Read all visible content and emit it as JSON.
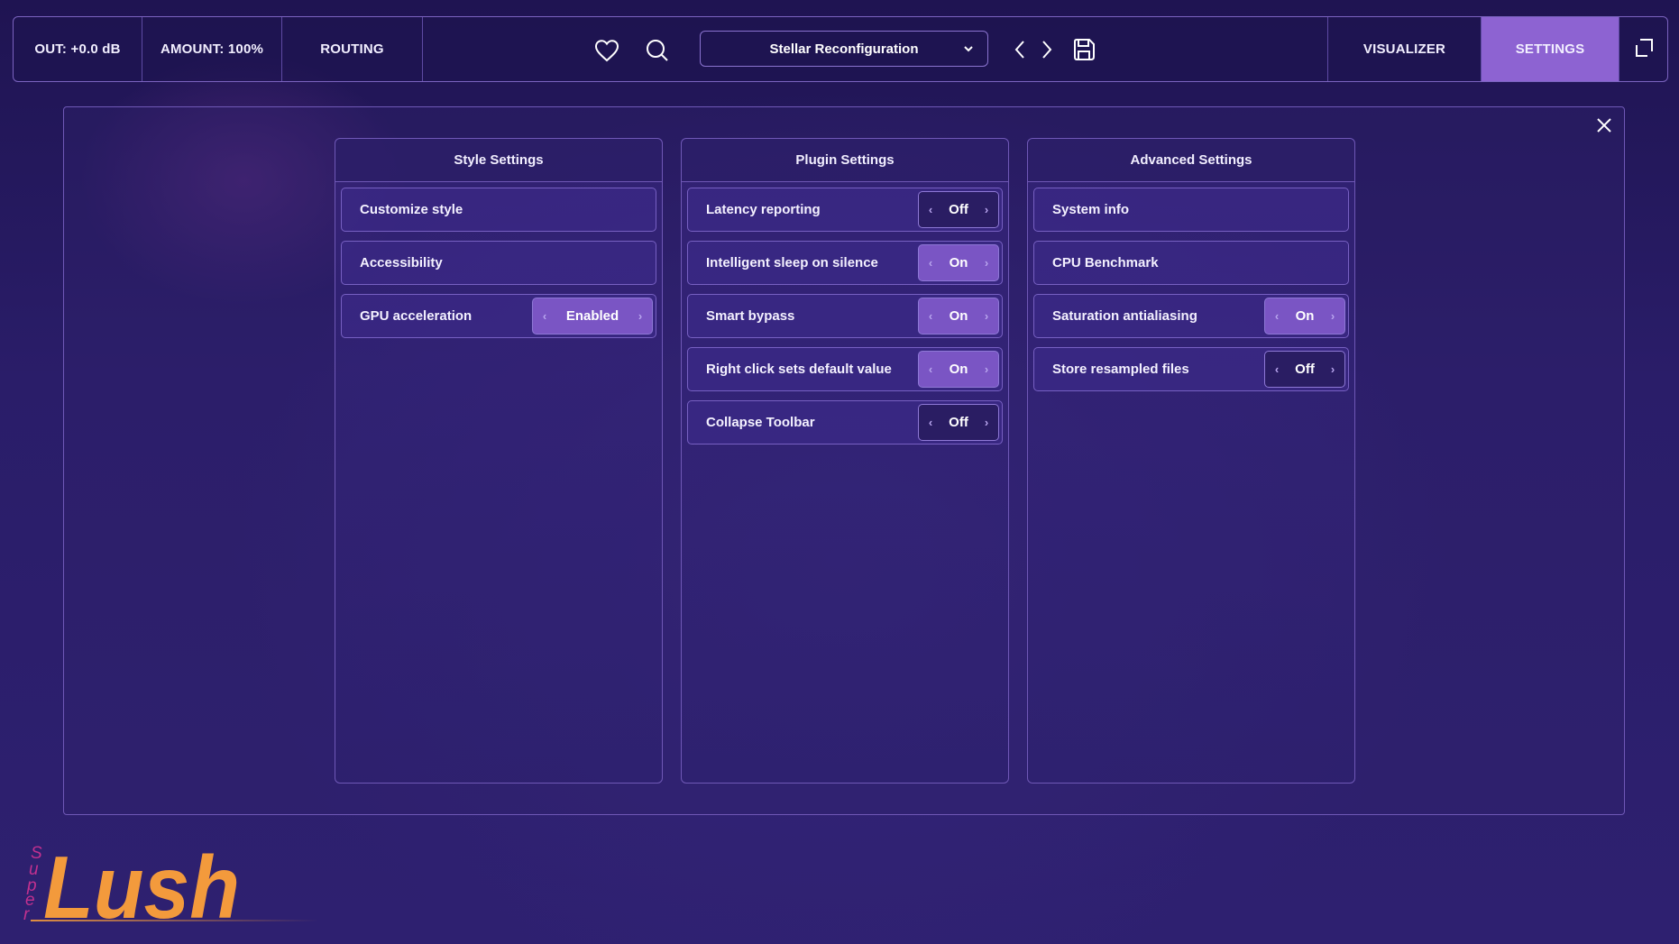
{
  "topbar": {
    "out": "OUT: +0.0 dB",
    "amount": "AMOUNT: 100%",
    "routing": "ROUTING",
    "preset": "Stellar Reconfiguration",
    "visualizer": "VISUALIZER",
    "settings": "SETTINGS",
    "icons": [
      "heart-icon",
      "search-icon",
      "chevron-down-icon",
      "chevron-left-icon",
      "chevron-right-icon",
      "save-icon",
      "expand-icon"
    ]
  },
  "panel": {
    "columns": [
      {
        "title": "Style Settings",
        "rows": [
          {
            "label": "Customize style"
          },
          {
            "label": "Accessibility"
          },
          {
            "label": "GPU acceleration",
            "value": "Enabled",
            "state": "on"
          }
        ]
      },
      {
        "title": "Plugin Settings",
        "rows": [
          {
            "label": "Latency reporting",
            "value": "Off",
            "state": "off"
          },
          {
            "label": "Intelligent sleep on silence",
            "value": "On",
            "state": "on"
          },
          {
            "label": "Smart bypass",
            "value": "On",
            "state": "on"
          },
          {
            "label": "Right click sets default value",
            "value": "On",
            "state": "on"
          },
          {
            "label": "Collapse Toolbar",
            "value": "Off",
            "state": "off"
          }
        ]
      },
      {
        "title": "Advanced Settings",
        "rows": [
          {
            "label": "System info"
          },
          {
            "label": "CPU Benchmark"
          },
          {
            "label": "Saturation antialiasing",
            "value": "On",
            "state": "on"
          },
          {
            "label": "Store resampled files",
            "value": "Off",
            "state": "off"
          }
        ]
      }
    ]
  },
  "logo": {
    "super": "Super",
    "main": "Lush"
  },
  "colors": {
    "accent": "#8d63d2",
    "toggle_on": "#7a55c4",
    "logo_orange": "#f39a3c",
    "logo_magenta": "#c2318f"
  }
}
